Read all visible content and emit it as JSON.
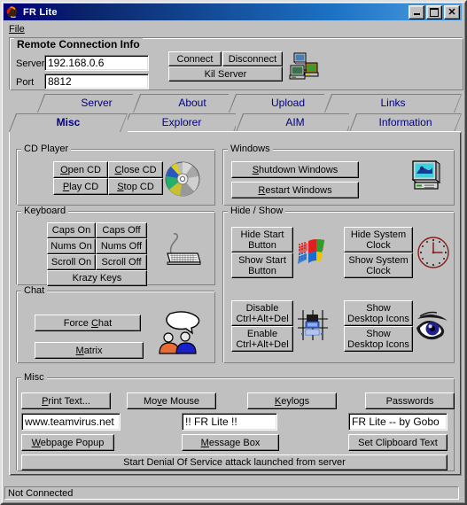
{
  "window": {
    "title": "FR Lite",
    "icon": "app-face-icon",
    "controls": {
      "minimize": "minimize-button",
      "maximize": "maximize-button",
      "close": "close-button"
    }
  },
  "menu": {
    "items": [
      {
        "label": "File",
        "accel": "F"
      }
    ]
  },
  "remote_connection": {
    "group_label": "Remote Connection Info",
    "server_label": "Server",
    "server_value": "192.168.0.6",
    "port_label": "Port",
    "port_value": "8812",
    "connect_label": "Connect",
    "disconnect_label": "Disconnect",
    "kill_server_label": "Kil Server",
    "icon": "network-computers-icon"
  },
  "tabs": {
    "row1": [
      {
        "label": "Server",
        "active": false
      },
      {
        "label": "About",
        "active": false
      },
      {
        "label": "Upload",
        "active": false
      },
      {
        "label": "Links",
        "active": false
      }
    ],
    "row2": [
      {
        "label": "Misc",
        "active": true
      },
      {
        "label": "Explorer",
        "active": false
      },
      {
        "label": "AIM",
        "active": false
      },
      {
        "label": "Information",
        "active": false
      }
    ]
  },
  "cd_player": {
    "group_label": "CD Player",
    "buttons": [
      {
        "label": "Open CD",
        "accel": "O"
      },
      {
        "label": "Close CD",
        "accel": "C"
      },
      {
        "label": "Play CD",
        "accel": "P"
      },
      {
        "label": "Stop CD",
        "accel": "S"
      }
    ],
    "icon": "compact-disc-icon"
  },
  "keyboard": {
    "group_label": "Keyboard",
    "buttons": [
      {
        "label": "Caps On"
      },
      {
        "label": "Caps Off"
      },
      {
        "label": "Nums On"
      },
      {
        "label": "Nums Off"
      },
      {
        "label": "Scroll On"
      },
      {
        "label": "Scroll Off"
      },
      {
        "label": "Krazy Keys"
      }
    ],
    "icon": "keyboard-icon"
  },
  "chat": {
    "group_label": "Chat",
    "force_chat_label": "Force Chat",
    "force_chat_accel": "C",
    "matrix_label": "Matrix",
    "matrix_accel": "M",
    "icon": "chat-people-icon"
  },
  "windows_section": {
    "group_label": "Windows",
    "shutdown_label": "Shutdown Windows",
    "shutdown_accel": "S",
    "restart_label": "Restart Windows",
    "restart_accel": "R",
    "icon": "monitor-icon"
  },
  "hide_show": {
    "group_label": "Hide / Show",
    "hide_start_line1": "Hide Start",
    "hide_start_line2": "Button",
    "show_start_line1": "Show Start",
    "show_start_line2": "Button",
    "start_icon": "windows-logo-icon",
    "hide_clock_line1": "Hide System",
    "hide_clock_line2": "Clock",
    "show_clock_line1": "Show System",
    "show_clock_line2": "Clock",
    "clock_icon": "clock-icon",
    "disable_cad_line1": "Disable",
    "disable_cad_line2": "Ctrl+Alt+Del",
    "enable_cad_line1": "Enable",
    "enable_cad_line2": "Ctrl+Alt+Del",
    "cad_icon": "task-grid-icon",
    "hide_icons_line1": "Show",
    "hide_icons_line2": "Desktop Icons",
    "show_icons_line1": "Show",
    "show_icons_line2": "Desktop Icons",
    "eye_icon": "eye-icon"
  },
  "misc": {
    "group_label": "Misc",
    "print_text_label": "Print Text...",
    "print_text_accel": "P",
    "move_mouse_label": "Move Mouse",
    "move_mouse_accel": "v",
    "keylogs_label": "Keylogs",
    "keylogs_accel": "K",
    "passwords_label": "Passwords",
    "webpage_value": "www.teamvirus.net",
    "webpage_popup_label": "Webpage Popup",
    "webpage_popup_accel": "W",
    "messagebox_value": "!! FR Lite !!",
    "messagebox_label": "Message Box",
    "messagebox_accel": "M",
    "clipboard_value": "FR Lite -- by Gobo",
    "clipboard_label": "Set Clipboard Text",
    "dos_label": "Start Denial Of Service attack launched from server"
  },
  "statusbar": {
    "text": "Not Connected"
  },
  "colors": {
    "face": "#c0c0c0",
    "title_left": "#00007b",
    "title_right": "#4f9fe0",
    "tab_text": "#000080",
    "clock_red": "#8b1a1a",
    "eye_blue": "#202090"
  }
}
